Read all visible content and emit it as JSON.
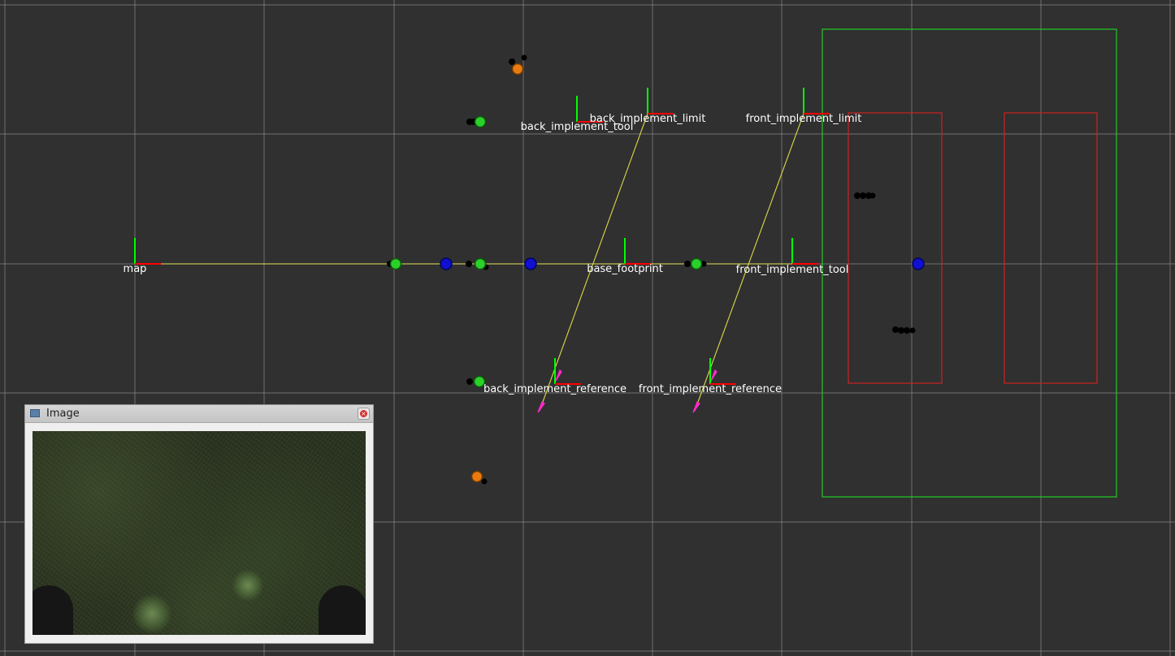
{
  "frames": {
    "map": "map",
    "back_implement_tool": "back_implement_tool",
    "back_implement_limit": "back_implement_limit",
    "front_implement_limit": "front_implement_limit",
    "base_footprint": "base_footprint",
    "front_implement_tool": "front_implement_tool",
    "back_implement_reference": "back_implement_reference",
    "front_implement_reference": "front_implement_reference"
  },
  "image_panel": {
    "title": "Image",
    "close_glyph": "×"
  },
  "colors": {
    "background": "#303030",
    "grid": "#a0a0a0",
    "axis_x": "#ff0000",
    "axis_y": "#00ff00",
    "tf_link": "#d8d84a",
    "marker_green": "#2ad12a",
    "marker_blue": "#1010d0",
    "marker_orange": "#e87a10",
    "zone_green": "#22cc22",
    "zone_red": "#cc2222",
    "arrow_magenta": "#ff2bc9"
  },
  "icons": {
    "title_icon": "image-icon",
    "close_icon": "close-icon"
  }
}
